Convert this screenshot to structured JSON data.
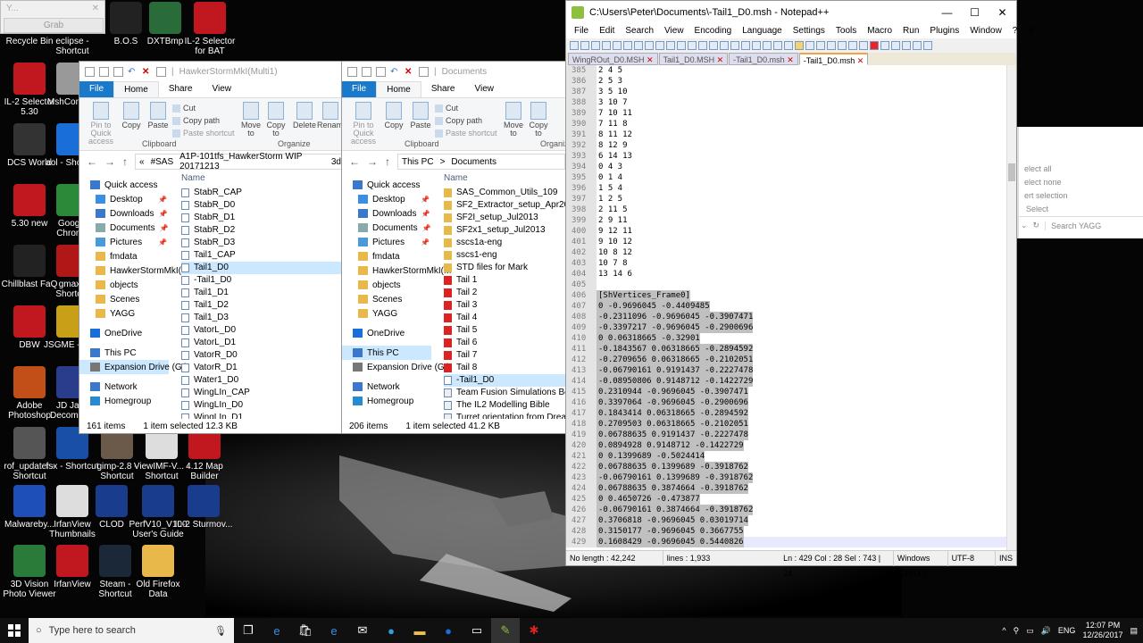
{
  "grab": {
    "title": "Y...",
    "button": "Grab"
  },
  "desktop_icons": [
    {
      "label": "Recycle Bin",
      "icon": "recycle-bin-icon",
      "color": "#6d7a86"
    },
    {
      "label": "eclipse - Shortcut",
      "icon": "eclipse-icon",
      "color": "#2c2255"
    },
    {
      "label": "B.O.S",
      "icon": "bos-icon",
      "color": "#222"
    },
    {
      "label": "DXTBmp",
      "icon": "dxtbmp-icon",
      "color": "#2a6b3a"
    },
    {
      "label": "IL-2 Selector for BAT",
      "icon": "il2-selector-icon",
      "color": "#c0181e"
    },
    {
      "label": "IL-2 Selector 5.30",
      "icon": "il2-selector-icon",
      "color": "#c0181e"
    },
    {
      "label": "MshConve...",
      "icon": "mshconverter-icon",
      "color": "#999"
    },
    {
      "label": "DCS World",
      "icon": "dcs-icon",
      "color": "#333"
    },
    {
      "label": "aol - Shortc...",
      "icon": "aol-icon",
      "color": "#1a6ed8"
    },
    {
      "label": "5.30 new",
      "icon": "il2-selector-icon",
      "color": "#c0181e"
    },
    {
      "label": "Google Chrome",
      "icon": "chrome-icon",
      "color": "#2a8a3a"
    },
    {
      "label": "Chillblast FaQ",
      "icon": "chillblast-icon",
      "color": "#222"
    },
    {
      "label": "gmax - Shortcut",
      "icon": "gmax-icon",
      "color": "#b01818"
    },
    {
      "label": "DBW",
      "icon": "il2-selector-icon",
      "color": "#c0181e"
    },
    {
      "label": "JSGME - Sh...",
      "icon": "jsgme-icon",
      "color": "#c8a018"
    },
    {
      "label": "Adobe Photoshop",
      "icon": "photoshop-icon",
      "color": "#c24e18"
    },
    {
      "label": "JD Java Decompil...",
      "icon": "jd-icon",
      "color": "#2a3c8c"
    },
    {
      "label": "rof_updater - Shortcut",
      "icon": "rof-icon",
      "color": "#555"
    },
    {
      "label": "fsx - Shortcut",
      "icon": "fsx-icon",
      "color": "#1a4fa8"
    },
    {
      "label": "gimp-2.8 - Shortcut",
      "icon": "gimp-icon",
      "color": "#6b5a4a"
    },
    {
      "label": "ViewIMF-V... - Shortcut",
      "icon": "viewimf-icon",
      "color": "#ddd"
    },
    {
      "label": "4.12 Map Builder",
      "icon": "il2-selector-icon",
      "color": "#c0181e"
    },
    {
      "label": "Malwareby...",
      "icon": "malwarebytes-icon",
      "color": "#1e4fb8"
    },
    {
      "label": "IrfanView Thumbnails",
      "icon": "irfanview-icon",
      "color": "#ddd"
    },
    {
      "label": "CLOD",
      "icon": "roundel-icon",
      "color": "#1a3c8c"
    },
    {
      "label": "PerfV10_V100 User's Guide",
      "icon": "epson-icon",
      "color": "#1a3c8c"
    },
    {
      "label": "IL-2 Sturmov...",
      "icon": "roundel-icon",
      "color": "#1a3c8c"
    },
    {
      "label": "3D Vision Photo Viewer",
      "icon": "3dvision-icon",
      "color": "#2a7a3a"
    },
    {
      "label": "IrfanView",
      "icon": "irfanview-icon",
      "color": "#c0181e"
    },
    {
      "label": "Steam - Shortcut",
      "icon": "steam-icon",
      "color": "#1b2838"
    },
    {
      "label": "Old Firefox Data",
      "icon": "folder-icon",
      "color": "#e8b84a"
    }
  ],
  "explorer1": {
    "title": "HawkerStormMkI(Multi1)",
    "menu": {
      "file": "File",
      "home": "Home",
      "share": "Share",
      "view": "View"
    },
    "ribbon": {
      "pin": "Pin to Quick access",
      "copy": "Copy",
      "paste": "Paste",
      "cut": "Cut",
      "copy_path": "Copy path",
      "paste_shortcut": "Paste shortcut",
      "clipboard": "Clipboard",
      "move_to": "Move to",
      "copy_to": "Copy to",
      "delete": "Delete",
      "rename": "Rename",
      "organize": "Organize"
    },
    "address": [
      "«",
      "#SAS",
      "A1P-101tfs_HawkerStorm WIP 20171213",
      "3d"
    ],
    "nav": [
      {
        "label": "Quick access",
        "icon": "star-icon",
        "pinned": false,
        "head": true
      },
      {
        "label": "Desktop",
        "icon": "desktop-icon",
        "pinned": true
      },
      {
        "label": "Downloads",
        "icon": "downloads-icon",
        "pinned": true
      },
      {
        "label": "Documents",
        "icon": "documents-icon",
        "pinned": true
      },
      {
        "label": "Pictures",
        "icon": "pictures-icon",
        "pinned": true
      },
      {
        "label": "fmdata",
        "icon": "folder-icon",
        "pinned": false
      },
      {
        "label": "HawkerStormMkI(M",
        "icon": "folder-icon",
        "pinned": false
      },
      {
        "label": "objects",
        "icon": "folder-icon",
        "pinned": false
      },
      {
        "label": "Scenes",
        "icon": "folder-icon",
        "pinned": false
      },
      {
        "label": "YAGG",
        "icon": "folder-icon",
        "pinned": false
      },
      {
        "label": "OneDrive",
        "icon": "onedrive-icon",
        "pinned": false,
        "head": true
      },
      {
        "label": "This PC",
        "icon": "pc-icon",
        "pinned": false,
        "head": true
      },
      {
        "label": "Expansion Drive (G:)",
        "icon": "drive-icon",
        "pinned": false,
        "head": true,
        "sel": true
      },
      {
        "label": "Network",
        "icon": "network-icon",
        "pinned": false,
        "head": true
      },
      {
        "label": "Homegroup",
        "icon": "homegroup-icon",
        "pinned": false,
        "head": true
      }
    ],
    "col_name": "Name",
    "files": [
      "StabR_CAP",
      "StabR_D0",
      "StabR_D1",
      "StabR_D2",
      "StabR_D3",
      "Tail1_CAP",
      "Tail1_D0",
      "-Tail1_D0",
      "Tail1_D1",
      "Tail1_D2",
      "Tail1_D3",
      "VatorL_D0",
      "VatorL_D1",
      "VatorR_D0",
      "VatorR_D1",
      "Water1_D0",
      "WingLIn_CAP",
      "WingLIn_D0",
      "WingLIn_D1"
    ],
    "selected_index": 6,
    "status": {
      "items": "161 items",
      "selected": "1 item selected  12.3 KB"
    }
  },
  "explorer2": {
    "title": "Documents",
    "menu": {
      "file": "File",
      "home": "Home",
      "share": "Share",
      "view": "View"
    },
    "ribbon": {
      "pin": "Pin to Quick access",
      "copy": "Copy",
      "paste": "Paste",
      "cut": "Cut",
      "copy_path": "Copy path",
      "paste_shortcut": "Paste shortcut",
      "clipboard": "Clipboard",
      "move_to": "Move to",
      "copy_to": "Copy to",
      "organize": "Organiz"
    },
    "address": [
      "This PC",
      ">",
      "Documents"
    ],
    "nav": [
      {
        "label": "Quick access",
        "icon": "star-icon",
        "pinned": false,
        "head": true
      },
      {
        "label": "Desktop",
        "icon": "desktop-icon",
        "pinned": true
      },
      {
        "label": "Downloads",
        "icon": "downloads-icon",
        "pinned": true
      },
      {
        "label": "Documents",
        "icon": "documents-icon",
        "pinned": true
      },
      {
        "label": "Pictures",
        "icon": "pictures-icon",
        "pinned": true
      },
      {
        "label": "fmdata",
        "icon": "folder-icon",
        "pinned": false
      },
      {
        "label": "HawkerStormMkI(M",
        "icon": "folder-icon",
        "pinned": false
      },
      {
        "label": "objects",
        "icon": "folder-icon",
        "pinned": false
      },
      {
        "label": "Scenes",
        "icon": "folder-icon",
        "pinned": false
      },
      {
        "label": "YAGG",
        "icon": "folder-icon",
        "pinned": false
      },
      {
        "label": "OneDrive",
        "icon": "onedrive-icon",
        "pinned": false,
        "head": true
      },
      {
        "label": "This PC",
        "icon": "pc-icon",
        "pinned": false,
        "head": true,
        "sel": true
      },
      {
        "label": "Expansion Drive (G:)",
        "icon": "drive-icon",
        "pinned": false,
        "head": true
      },
      {
        "label": "Network",
        "icon": "network-icon",
        "pinned": false,
        "head": true
      },
      {
        "label": "Homegroup",
        "icon": "homegroup-icon",
        "pinned": false,
        "head": true
      }
    ],
    "col_name": "Name",
    "files": [
      "SAS_Common_Utils_109",
      "SF2_Extractor_setup_Apr2012",
      "SF2I_setup_Jul2013",
      "SF2x1_setup_Jul2013",
      "sscs1a-eng",
      "sscs1-eng",
      "STD files for Mark",
      "Tail 1",
      "Tail 2",
      "Tail 3",
      "Tail 4",
      "Tail 5",
      "Tail 6",
      "Tail 7",
      "Tail 8",
      "-Tail1_D0",
      "Team Fusion Simulations Beginne",
      "The IL2 Modelling Bible",
      "Turret orientation from Dreamk"
    ],
    "selected_index": 15,
    "status": {
      "items": "206 items",
      "selected": "1 item selected  41.2 KB"
    }
  },
  "notepad": {
    "title": "C:\\Users\\Peter\\Documents\\-Tail1_D0.msh - Notepad++",
    "menu": [
      "File",
      "Edit",
      "Search",
      "View",
      "Encoding",
      "Language",
      "Settings",
      "Tools",
      "Macro",
      "Run",
      "Plugins",
      "Window",
      "?"
    ],
    "close_x": "X",
    "tabs": [
      "WingROut_D0.MSH",
      "Tail1_D0.MSH",
      "-Tail1_D0.msh",
      "-Tail1_D0.msh"
    ],
    "lines": [
      {
        "n": "385",
        "t": "2 4 5"
      },
      {
        "n": "386",
        "t": "2 5 3"
      },
      {
        "n": "387",
        "t": "3 5 10"
      },
      {
        "n": "388",
        "t": "3 10 7"
      },
      {
        "n": "389",
        "t": "7 10 11"
      },
      {
        "n": "390",
        "t": "7 11 8"
      },
      {
        "n": "391",
        "t": "8 11 12"
      },
      {
        "n": "392",
        "t": "8 12 9"
      },
      {
        "n": "393",
        "t": "6 14 13"
      },
      {
        "n": "394",
        "t": "0 4 3"
      },
      {
        "n": "395",
        "t": "0 1 4"
      },
      {
        "n": "396",
        "t": "1 5 4"
      },
      {
        "n": "397",
        "t": "1 2 5"
      },
      {
        "n": "398",
        "t": "2 11 5"
      },
      {
        "n": "399",
        "t": "2 9 11"
      },
      {
        "n": "400",
        "t": "9 12 11"
      },
      {
        "n": "401",
        "t": "9 10 12"
      },
      {
        "n": "402",
        "t": "10 8 12"
      },
      {
        "n": "403",
        "t": "10 7 8"
      },
      {
        "n": "404",
        "t": "13 14 6"
      },
      {
        "n": "405",
        "t": ""
      },
      {
        "n": "406",
        "t": "[ShVertices_Frame0]",
        "hl": true
      },
      {
        "n": "407",
        "t": "0 -0.9696045 -0.4409485",
        "hl": true
      },
      {
        "n": "408",
        "t": "-0.2311096 -0.9696045 -0.3907471",
        "hl": true
      },
      {
        "n": "409",
        "t": "-0.3397217 -0.9696045 -0.2900696",
        "hl": true
      },
      {
        "n": "410",
        "t": "0 0.06318665 -0.32901",
        "hl": true
      },
      {
        "n": "411",
        "t": "-0.1843567 0.06318665 -0.2894592",
        "hl": true
      },
      {
        "n": "412",
        "t": "-0.2709656 0.06318665 -0.2102051",
        "hl": true
      },
      {
        "n": "413",
        "t": "-0.06790161 0.9191437 -0.2227478",
        "hl": true
      },
      {
        "n": "414",
        "t": "-0.08950806 0.9148712 -0.1422729",
        "hl": true
      },
      {
        "n": "415",
        "t": "0.2310944 -0.9696045 -0.3907471",
        "hl": true
      },
      {
        "n": "416",
        "t": "0.3397064 -0.9696045 -0.2900696",
        "hl": true
      },
      {
        "n": "417",
        "t": "0.1843414 0.06318665 -0.2894592",
        "hl": true
      },
      {
        "n": "418",
        "t": "0.2709503 0.06318665 -0.2102051",
        "hl": true
      },
      {
        "n": "419",
        "t": "0.06788635 0.9191437 -0.2227478",
        "hl": true
      },
      {
        "n": "420",
        "t": "0.0894928 0.9148712 -0.1422729",
        "hl": true
      },
      {
        "n": "421",
        "t": "0 0.1399689 -0.5024414",
        "hl": true
      },
      {
        "n": "422",
        "t": "0.06788635 0.1399689 -0.3918762",
        "hl": true
      },
      {
        "n": "423",
        "t": "-0.06790161 0.1399689 -0.3918762",
        "hl": true
      },
      {
        "n": "424",
        "t": "0.06788635 0.3874664 -0.3918762",
        "hl": true
      },
      {
        "n": "425",
        "t": "0 0.4650726 -0.473877",
        "hl": true
      },
      {
        "n": "426",
        "t": "-0.06790161 0.3874664 -0.3918762",
        "hl": true
      },
      {
        "n": "427",
        "t": "0.3706818 -0.9696045 0.03019714",
        "hl": true
      },
      {
        "n": "428",
        "t": "0.3150177 -0.9696045 0.3667755",
        "hl": true
      },
      {
        "n": "429",
        "t": "0.1608429 -0.9696045 0.5440826",
        "hl": true,
        "cur": true
      }
    ],
    "status": {
      "length": "No length : 42,242",
      "lines": "lines : 1,933",
      "pos": "Ln : 429   Col : 28   Sel : 743 | 24",
      "eol": "Windows (CR LF)",
      "enc": "UTF-8",
      "mode": "INS"
    }
  },
  "yagg": {
    "select_all": "elect all",
    "select_none": "elect none",
    "invert": "ert selection",
    "select": "Select",
    "search": "Search YAGG"
  },
  "taskbar": {
    "search_placeholder": "Type here to search",
    "lang": "ENG",
    "time": "12:07 PM",
    "date": "12/26/2017"
  }
}
